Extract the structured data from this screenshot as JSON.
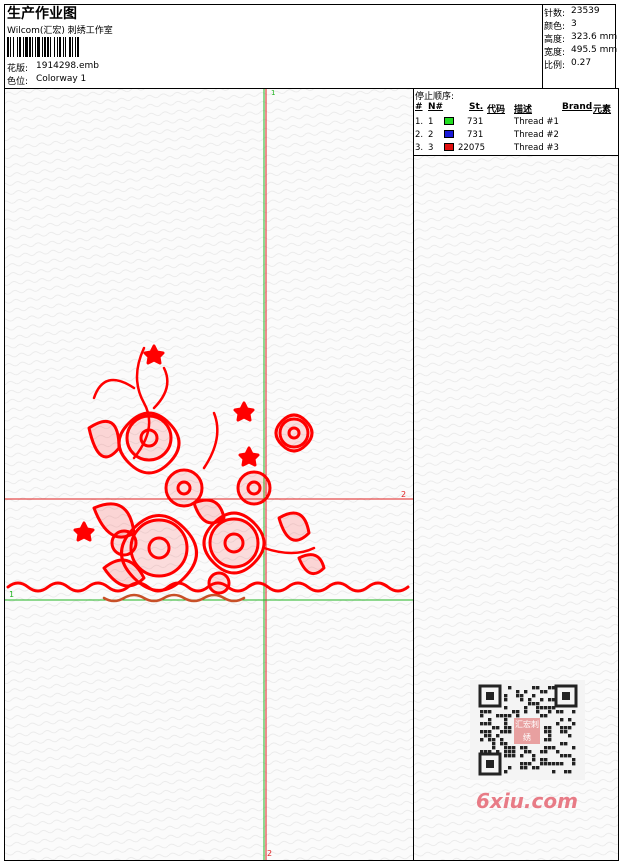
{
  "header": {
    "title": "生产作业图",
    "company": "Wilcom(汇宏) 刺绣工作室",
    "design_label": "花版:",
    "design_value": "1914298.emb",
    "colorway_label": "色位:",
    "colorway_value": "Colorway 1"
  },
  "stats": [
    {
      "label": "针数:",
      "value": "23539"
    },
    {
      "label": "颜色:",
      "value": "3"
    },
    {
      "label": "高度:",
      "value": "323.6 mm"
    },
    {
      "label": "宽度:",
      "value": "495.5 mm"
    },
    {
      "label": "比例:",
      "value": "0.27"
    }
  ],
  "stop_sequence": {
    "title": "停止顺序:",
    "columns": [
      "#",
      "N#",
      "St.",
      "代码",
      "描述",
      "Brand",
      "元素"
    ],
    "rows": [
      {
        "index": "1.",
        "needle": "1",
        "color": "#22dd22",
        "code": "731",
        "desc": "Thread #1"
      },
      {
        "index": "2.",
        "needle": "2",
        "color": "#1a1ad8",
        "code": "731",
        "desc": "Thread #2"
      },
      {
        "index": "3.",
        "needle": "3",
        "color": "#e01010",
        "code": "22075",
        "desc": "Thread #3"
      }
    ]
  },
  "canvas": {
    "marker_top": "1",
    "marker_right": "2",
    "marker_left": "1",
    "marker_bottom": "2",
    "design_color": "#ff0000"
  },
  "watermark": {
    "site": "6xiu.com",
    "stamp": "汇宏刺绣"
  }
}
